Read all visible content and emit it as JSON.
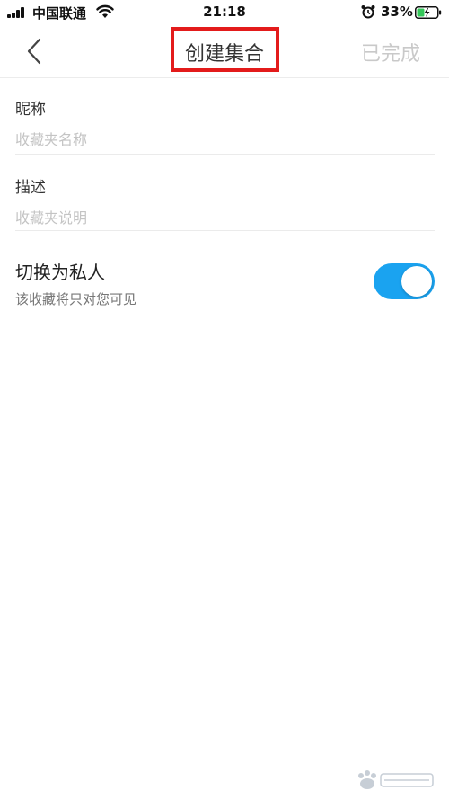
{
  "status_bar": {
    "carrier": "中国联通",
    "time": "21:18",
    "battery_percent": "33%",
    "icons": [
      "signal-icon",
      "wifi-icon",
      "alarm-icon",
      "battery-charging-icon"
    ]
  },
  "nav": {
    "back_icon": "chevron-left-icon",
    "title": "创建集合",
    "done_label": "已完成"
  },
  "form": {
    "name": {
      "label": "昵称",
      "value": "",
      "placeholder": "收藏夹名称"
    },
    "description": {
      "label": "描述",
      "value": "",
      "placeholder": "收藏夹说明"
    },
    "private": {
      "title": "切换为私人",
      "description": "该收藏将只对您可见",
      "enabled": true
    }
  },
  "colors": {
    "toggle_on": "#1aa3f0",
    "highlight_box": "#e31b1b",
    "done_disabled": "#c9c9c9"
  },
  "watermark": {
    "icon": "baidu-jingyan-logo"
  }
}
